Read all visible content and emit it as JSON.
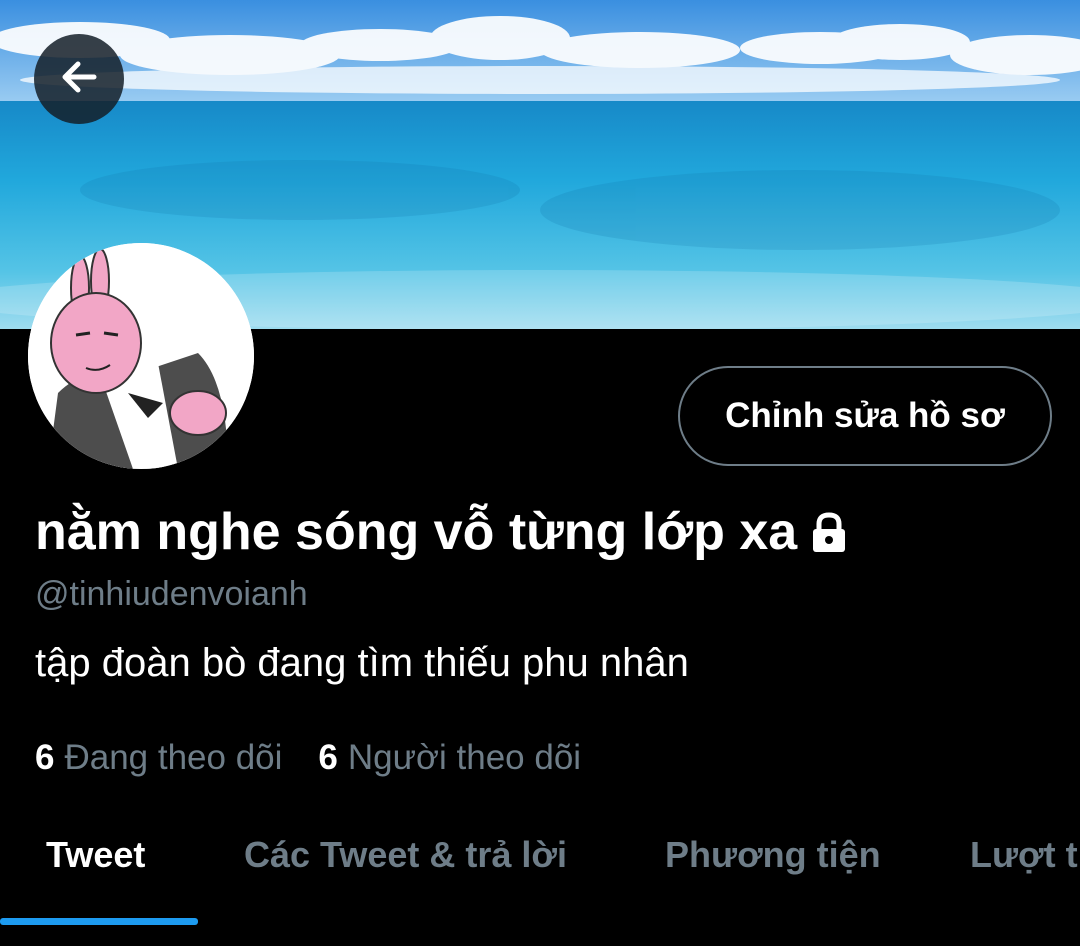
{
  "header": {
    "back_icon": "arrow-left-icon"
  },
  "profile": {
    "display_name": "nằm nghe sóng vỗ từng lớp xa",
    "protected_icon": "lock-icon",
    "handle": "@tinhiudenvoianh",
    "bio": "tập đoàn bò đang tìm thiếu phu nhân",
    "edit_profile_label": "Chỉnh sửa hồ sơ"
  },
  "stats": {
    "following_count": "6",
    "following_label": "Đang theo dõi",
    "followers_count": "6",
    "followers_label": "Người theo dõi"
  },
  "tabs": [
    {
      "label": "Tweet",
      "active": true
    },
    {
      "label": "Các Tweet & trả lời",
      "active": false
    },
    {
      "label": "Phương tiện",
      "active": false
    },
    {
      "label": "Lượt thích",
      "active": false
    }
  ],
  "colors": {
    "background": "#000000",
    "secondary_text": "#6e7d88",
    "accent": "#1d9bf0",
    "button_border": "#6e7d88"
  }
}
